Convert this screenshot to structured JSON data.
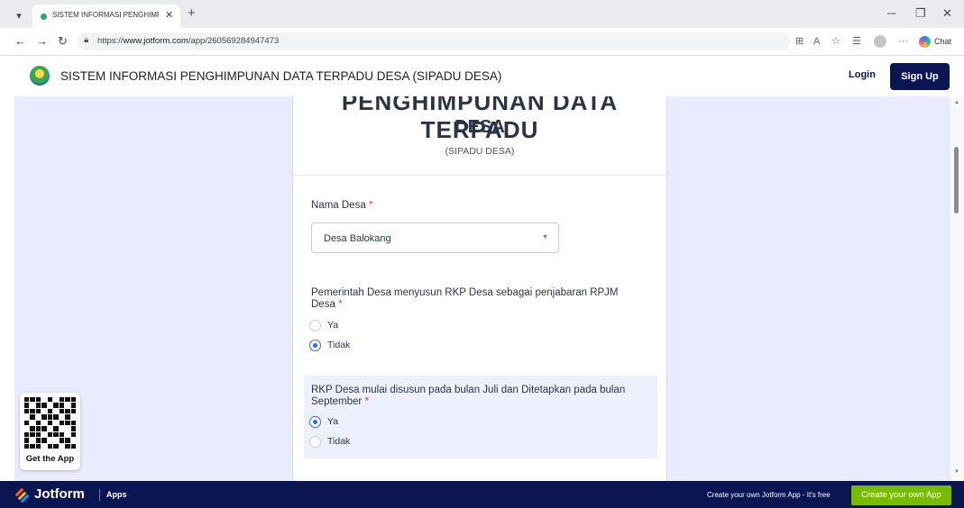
{
  "browser": {
    "tab_title": "SISTEM INFORMASI PENGHIMPUN",
    "tab_close": "✕",
    "new_tab": "+",
    "url_prefix": "https://",
    "url_domain": "www.jotform.com",
    "url_path": "/app/260569284947473",
    "chat_label": "Chat",
    "back_icon": "arrow-left-icon",
    "forward_icon": "arrow-right-icon",
    "refresh_icon": "refresh-icon"
  },
  "header": {
    "title": "SISTEM INFORMASI PENGHIMPUNAN DATA TERPADU DESA (SIPADU DESA)",
    "login_label": "Login",
    "signup_label": "Sign Up"
  },
  "form": {
    "heading_line1": "PENGHIMPUNAN DATA TERPADU",
    "heading_line2": "DESA",
    "subheading": "(SIPADU DESA)",
    "required_mark": "*",
    "q1": {
      "label": "Nama Desa",
      "value": "Desa Balokang"
    },
    "q2": {
      "label": "Pemerintah Desa menyusun RKP Desa sebagai penjabaran RPJM Desa",
      "options": [
        "Ya",
        "Tidak"
      ],
      "selected": "Tidak"
    },
    "q3": {
      "label": "RKP Desa mulai disusun pada bulan Juli dan Ditetapkan pada bulan September",
      "options": [
        "Ya",
        "Tidak"
      ],
      "selected": "Ya"
    }
  },
  "get_app": {
    "label": "Get the App"
  },
  "footer": {
    "brand": "Jotform",
    "apps_label": "Apps",
    "note": "Create your own Jotform App - It's free",
    "cta_label": "Create your own App"
  },
  "colors": {
    "navy": "#0a1551",
    "accent_blue": "#2e69ff",
    "required_red": "#f23a3c",
    "cta_green": "#78bb07",
    "page_bg": "#ebebff"
  }
}
